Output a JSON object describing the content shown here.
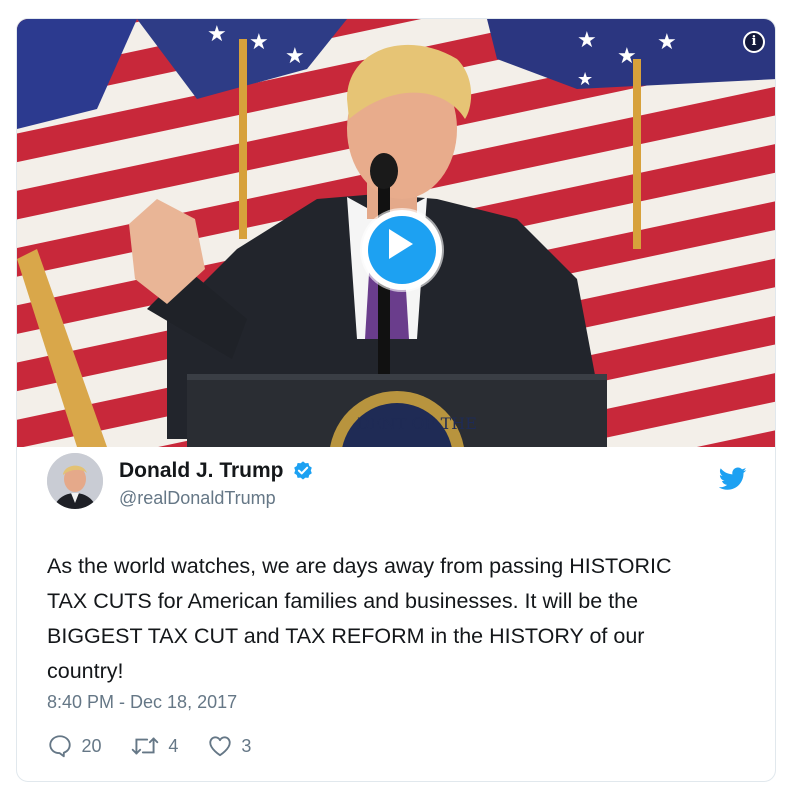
{
  "media": {
    "type": "video",
    "play_icon": "play-icon",
    "info_icon": "info-icon",
    "info_label": "i",
    "seal_text": "DENT OF THE"
  },
  "author": {
    "name": "Donald J. Trump",
    "handle": "@realDonaldTrump",
    "verified": true,
    "avatar": "avatar-photo"
  },
  "tweet": {
    "text": "As the world watches, we are days away from passing HISTORIC\nTAX CUTS for American families and businesses. It will be the\nBIGGEST TAX CUT and TAX REFORM in the HISTORY of our\ncountry!",
    "timestamp": "8:40 PM - Dec 18, 2017"
  },
  "actions": {
    "replies": "20",
    "retweets": "4",
    "likes": "3"
  },
  "colors": {
    "accent": "#1da1f2",
    "text": "#14171a",
    "muted": "#657786",
    "border": "#e1e8ed"
  }
}
